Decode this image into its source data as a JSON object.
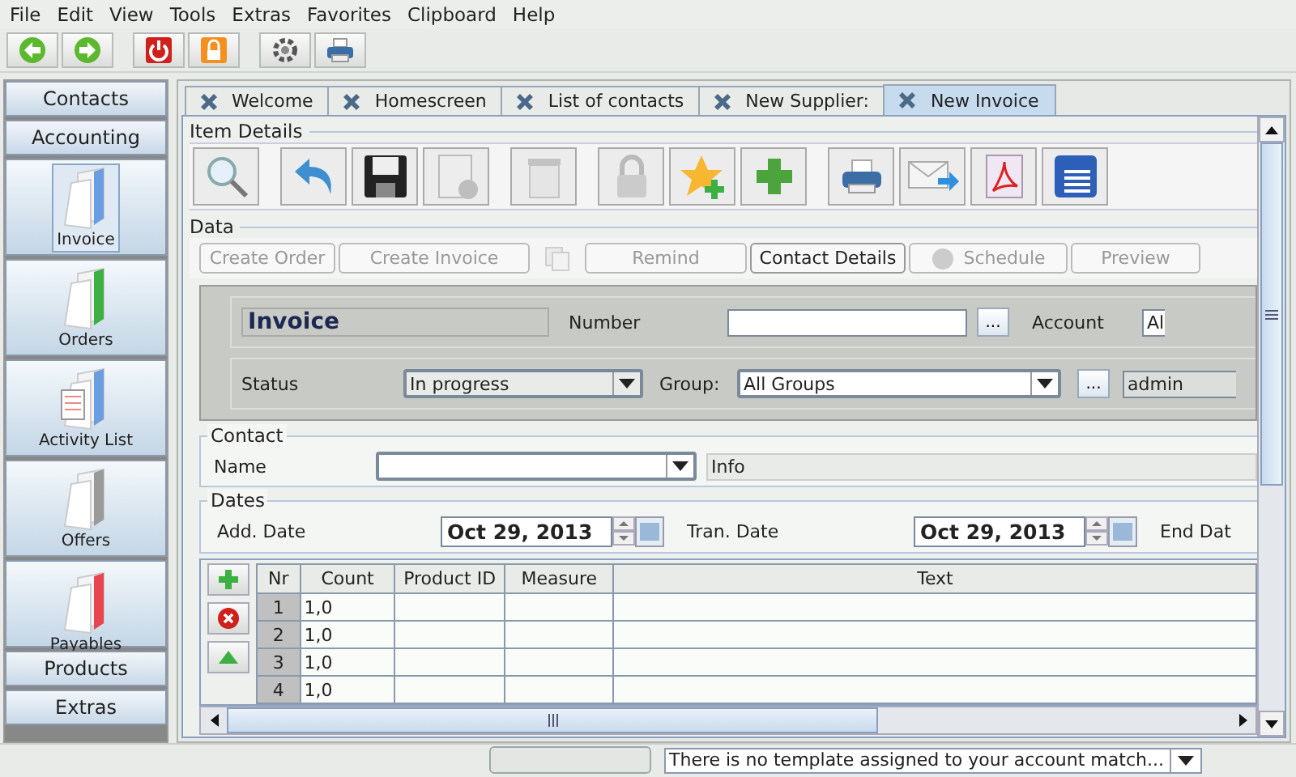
{
  "menu": [
    "File",
    "Edit",
    "View",
    "Tools",
    "Extras",
    "Favorites",
    "Clipboard",
    "Help"
  ],
  "sidebar": {
    "sections": [
      {
        "label": "Contacts"
      },
      {
        "label": "Accounting"
      }
    ],
    "items": [
      {
        "label": "Invoice",
        "selected": true,
        "color": "#6a9ee0"
      },
      {
        "label": "Orders",
        "selected": false,
        "color": "#3cb043"
      },
      {
        "label": "Activity List",
        "selected": false,
        "color": "#6a9ee0"
      },
      {
        "label": "Offers",
        "selected": false,
        "color": "#9a9a9a"
      },
      {
        "label": "Payables",
        "selected": false,
        "color": "#e8454f"
      }
    ],
    "bottom_sections": [
      {
        "label": "Products"
      },
      {
        "label": "Extras"
      }
    ]
  },
  "tabs": [
    {
      "label": "Welcome",
      "selected": false
    },
    {
      "label": "Homescreen",
      "selected": false
    },
    {
      "label": "List of contacts",
      "selected": false
    },
    {
      "label": "New Supplier:",
      "selected": false
    },
    {
      "label": "New Invoice",
      "selected": true
    }
  ],
  "item_details": {
    "title": "Item Details",
    "icons": [
      {
        "kind": "search",
        "disabled": false
      },
      {
        "kind": "undo",
        "disabled": false
      },
      {
        "kind": "save",
        "disabled": false
      },
      {
        "kind": "new-doc",
        "disabled": true
      },
      {
        "kind": "trash",
        "disabled": true
      },
      {
        "kind": "lock",
        "disabled": true
      },
      {
        "kind": "star-plus",
        "disabled": false
      },
      {
        "kind": "plus",
        "disabled": false
      },
      {
        "kind": "print",
        "disabled": false
      },
      {
        "kind": "mail",
        "disabled": false
      },
      {
        "kind": "pdf",
        "disabled": false
      },
      {
        "kind": "doc",
        "disabled": false
      }
    ]
  },
  "data": {
    "title": "Data",
    "buttons": [
      {
        "kind": "text",
        "label": "Create Order",
        "disabled": true
      },
      {
        "kind": "text",
        "label": "Create Invoice",
        "disabled": true
      },
      {
        "kind": "copy",
        "disabled": true
      },
      {
        "kind": "text",
        "label": "Remind",
        "disabled": true
      },
      {
        "kind": "text",
        "label": "Contact Details",
        "disabled": false
      },
      {
        "kind": "schedule",
        "label": "Schedule",
        "disabled": true
      },
      {
        "kind": "text",
        "label": "Preview",
        "disabled": true
      }
    ]
  },
  "header": {
    "title": "Invoice",
    "number_label": "Number",
    "number_browse": "...",
    "account_label": "Account",
    "account": "Al",
    "status_label": "Status",
    "status": "In progress",
    "group_label": "Group:",
    "group": "All Groups",
    "group_browse": "...",
    "user": "admin"
  },
  "contact": {
    "title": "Contact",
    "name_label": "Name",
    "info": "Info"
  },
  "dates": {
    "title": "Dates",
    "fields": [
      {
        "label": "Add. Date",
        "value": "Oct 29, 2013"
      },
      {
        "label": "Tran. Date",
        "value": "Oct 29, 2013"
      }
    ],
    "cut_label": "End Dat"
  },
  "table": {
    "columns": [
      "Nr",
      "Count",
      "Product ID",
      "Measure",
      "Text"
    ],
    "rows": [
      {
        "nr": "1",
        "count": "1,0"
      },
      {
        "nr": "2",
        "count": "1,0"
      },
      {
        "nr": "3",
        "count": "1,0"
      },
      {
        "nr": "4",
        "count": "1,0"
      }
    ]
  },
  "status_bar": {
    "message": "There is no template assigned to your account match..."
  }
}
